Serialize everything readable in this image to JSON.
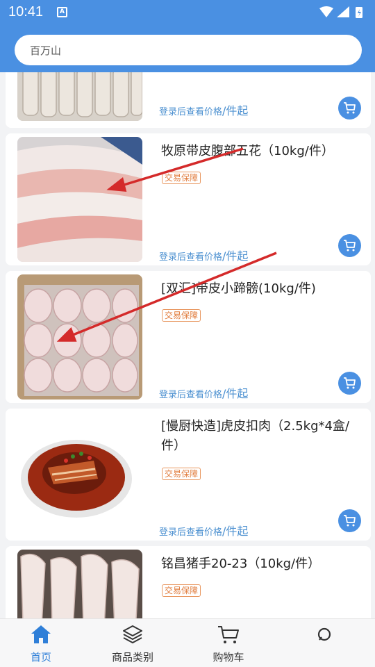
{
  "status_bar": {
    "time": "10:41",
    "notification_glyph": "A"
  },
  "search": {
    "text": "百万山"
  },
  "products": [
    {
      "title": "",
      "badge": "",
      "price_text": "登录后查看价格",
      "price_unit": "/件起"
    },
    {
      "title": "牧原带皮腹部五花（10kg/件）",
      "badge": "交易保障",
      "price_text": "登录后查看价格",
      "price_unit": "/件起"
    },
    {
      "title": "[双汇]带皮小蹄髈(10kg/件)",
      "badge": "交易保障",
      "price_text": "登录后查看价格",
      "price_unit": "/件起"
    },
    {
      "title": "[慢厨快造]虎皮扣肉（2.5kg*4盒/件）",
      "badge": "交易保障",
      "price_text": "登录后查看价格",
      "price_unit": "/件起"
    },
    {
      "title": "铭昌猪手20-23（10kg/件）",
      "badge": "交易保障",
      "price_text": "",
      "price_unit": ""
    }
  ],
  "tabbar": [
    {
      "label": "首页",
      "icon": "home-icon",
      "active": true
    },
    {
      "label": "商品类别",
      "icon": "layers-icon",
      "active": false
    },
    {
      "label": "购物车",
      "icon": "cart-icon",
      "active": false
    },
    {
      "label": "",
      "icon": "profile-icon",
      "active": false
    }
  ],
  "colors": {
    "brand": "#4a90e2",
    "badge": "#e07a3a",
    "price": "#4a8fd0",
    "annotation_arrow": "#d42a2a"
  }
}
